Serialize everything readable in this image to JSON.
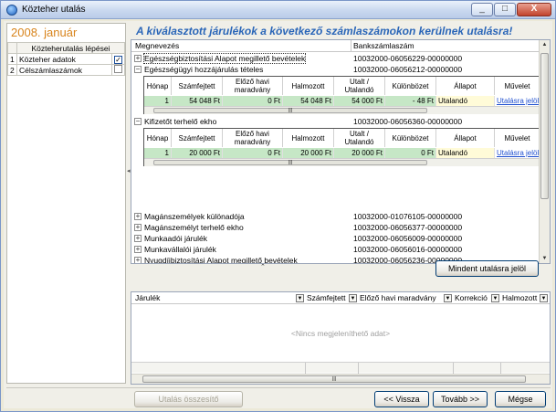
{
  "window": {
    "title": "Közteher utalás",
    "controls": {
      "minimize": "_",
      "maximize": "□",
      "close": "X"
    }
  },
  "left_panel": {
    "period": "2008. január",
    "steps_header": "Közteherutalás lépései",
    "steps": [
      {
        "num": "1",
        "label": "Közteher adatok",
        "checked": "✓"
      },
      {
        "num": "2",
        "label": "Célszámlaszámok",
        "checked": ""
      }
    ]
  },
  "headline": "A kiválasztott járulékok a következő számlaszámokon kerülnek utalásra!",
  "top_grid": {
    "columns": {
      "name": "Megnevezés",
      "account": "Bankszámlaszám"
    },
    "rows": [
      {
        "expander": "+",
        "name": "Egészségbiztosítási Alapot megillető bevételek",
        "account": "10032000-06056229-00000000"
      },
      {
        "expander": "−",
        "name": "Egészségügyi hozzájárulás tételes",
        "account": "10032000-06056212-00000000"
      },
      {
        "expander": "−",
        "name": "Kifizetőt terhelő ekho",
        "account": "10032000-06056360-00000000"
      },
      {
        "expander": "+",
        "name": "Magánszemélyek különadója",
        "account": "10032000-01076105-00000000"
      },
      {
        "expander": "+",
        "name": "Magánszemélyt terhelő ekho",
        "account": "10032000-06056377-00000000"
      },
      {
        "expander": "+",
        "name": "Munkaadói járulék",
        "account": "10032000-06056009-00000000"
      },
      {
        "expander": "+",
        "name": "Munkavállalói járulék",
        "account": "10032000-06056016-00000000"
      },
      {
        "expander": "+",
        "name": "Nyugdíjbiztosítási Alapot megillető bevételek",
        "account": "10032000-06056236-00000000"
      }
    ],
    "sub_columns": {
      "month": "Hónap",
      "billed": "Számfejtett",
      "prev": "Előző havi maradvány",
      "accum": "Halmozott",
      "transfer": "Utalt / Utalandó",
      "diff": "Különbözet",
      "status": "Állapot",
      "action": "Művelet"
    },
    "sub1": {
      "month": "1",
      "billed": "54 048 Ft",
      "prev": "0 Ft",
      "accum": "54 048 Ft",
      "transfer": "54 000 Ft",
      "diff": "- 48 Ft",
      "status": "Utalandó",
      "action": "Utalásra jelöl"
    },
    "sub2": {
      "month": "1",
      "billed": "20 000 Ft",
      "prev": "0 Ft",
      "accum": "20 000 Ft",
      "transfer": "20 000 Ft",
      "diff": "0 Ft",
      "status": "Utalandó",
      "action": "Utalásra jelöl"
    }
  },
  "mark_all_button": "Mindent utalásra jelöl",
  "bottom_grid": {
    "columns": {
      "jarulek": "Járulék",
      "billed": "Számfejtett",
      "prev": "Előző havi maradvány",
      "correction": "Korrekció",
      "accum": "Halmozott"
    },
    "empty_text": "<Nincs megjeleníthető adat>"
  },
  "footer": {
    "summary_button": "Utalás összesítő",
    "back_button": "<< Vissza",
    "next_button": "Tovább >>",
    "cancel_button": "Mégse"
  },
  "colors": {
    "headline": "#2a66b8",
    "period": "#d8841c",
    "row_green": "#c6e7c6",
    "row_yellow": "#fffbd8"
  }
}
